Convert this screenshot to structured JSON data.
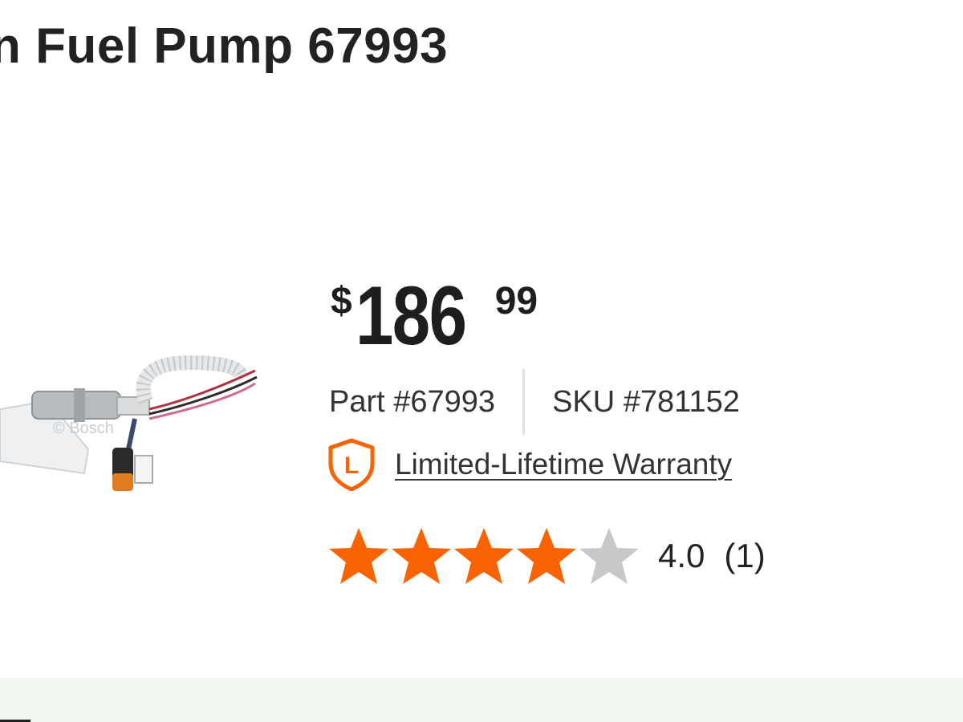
{
  "product": {
    "title": "n Fuel Pump 67993",
    "image_alt": "Fuel pump product image",
    "watermark": "© Bosch"
  },
  "price": {
    "currency": "$",
    "dollars": "186",
    "cents": "99"
  },
  "identifiers": {
    "part": "Part #67993",
    "sku": "SKU #781152"
  },
  "warranty": {
    "icon": "warranty-shield-icon",
    "icon_letter": "L",
    "label": "Limited-Lifetime Warranty"
  },
  "rating": {
    "value": 4.0,
    "out_of": 5,
    "score_text": "4.0",
    "count_text": "(1)"
  },
  "colors": {
    "accent_orange": "#f96302",
    "star_empty": "#c8c8c8",
    "bottom_bar": "#f2f7f2"
  }
}
